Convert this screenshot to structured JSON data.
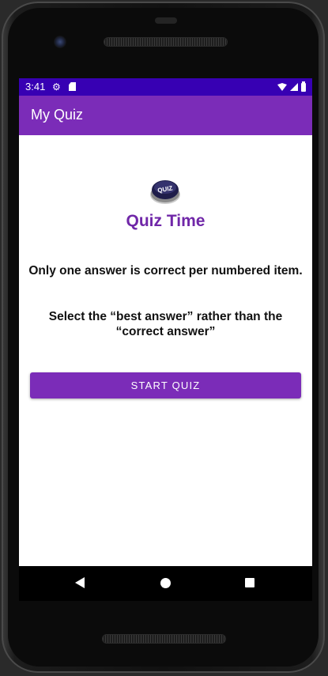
{
  "status_bar": {
    "time": "3:41",
    "icons": [
      "gear-icon",
      "sd-card-icon",
      "wifi-icon",
      "signal-icon",
      "battery-icon"
    ],
    "background": "#3700b3"
  },
  "app_bar": {
    "title": "My Quiz",
    "background": "#7b2cb8"
  },
  "main": {
    "logo": {
      "text": "QUIZ",
      "icon": "quiz-button-logo"
    },
    "heading": "Quiz Time",
    "heading_color": "#7027a8",
    "instructions": [
      "Only one answer is correct per numbered item.",
      "Select the “best answer” rather than the “correct answer”"
    ],
    "start_button": {
      "label": "START QUIZ",
      "color": "#7b2cb8"
    }
  },
  "nav_bar": {
    "icons": [
      "back-icon",
      "home-icon",
      "recents-icon"
    ]
  }
}
